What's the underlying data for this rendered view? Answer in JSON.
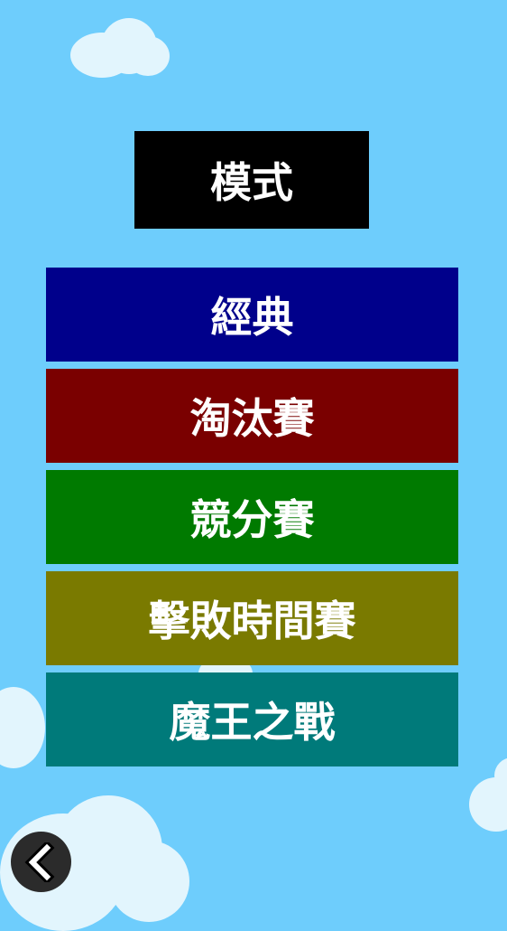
{
  "screen": {
    "title": "模式",
    "background_color": "#6ecdfc"
  },
  "modes": [
    {
      "label": "經典",
      "color": "#00008b"
    },
    {
      "label": "淘汰賽",
      "color": "#7a0000"
    },
    {
      "label": "競分賽",
      "color": "#007a00"
    },
    {
      "label": "擊敗時間賽",
      "color": "#7a7a00"
    },
    {
      "label": "魔王之戰",
      "color": "#007a7a"
    }
  ],
  "back_button": {
    "icon": "chevron-left-icon"
  }
}
